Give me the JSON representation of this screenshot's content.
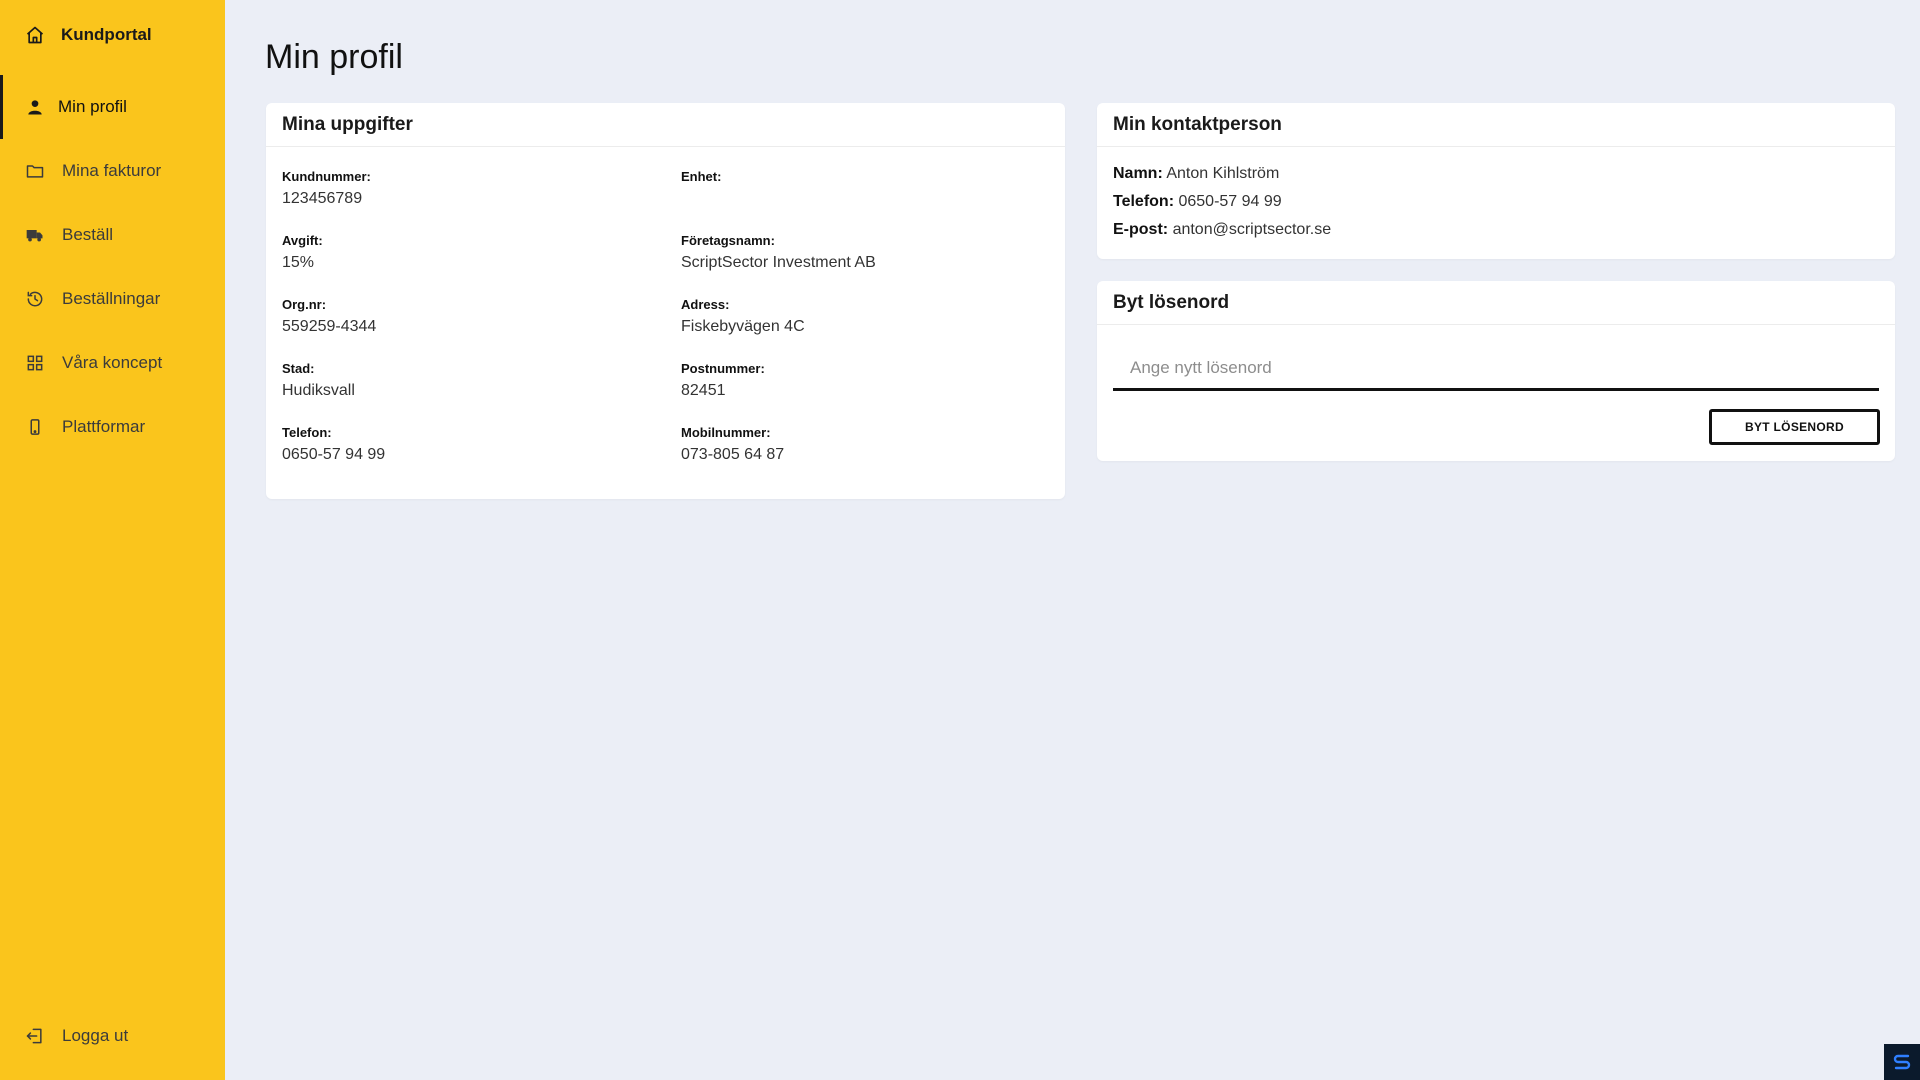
{
  "sidebar": {
    "brand": {
      "label": "Kundportal",
      "icon": "home-icon"
    },
    "items": [
      {
        "label": "Min profil",
        "icon": "user-icon",
        "active": true
      },
      {
        "label": "Mina fakturor",
        "icon": "folder-icon"
      },
      {
        "label": "Beställ",
        "icon": "truck-icon"
      },
      {
        "label": "Beställningar",
        "icon": "history-icon"
      },
      {
        "label": "Våra koncept",
        "icon": "grid-icon"
      },
      {
        "label": "Plattformar",
        "icon": "mobile-icon"
      }
    ],
    "logout": {
      "label": "Logga ut",
      "icon": "logout-icon"
    }
  },
  "page": {
    "title": "Min profil"
  },
  "details": {
    "title": "Mina uppgifter",
    "fields": [
      {
        "label": "Kundnummer:",
        "value": "123456789"
      },
      {
        "label": "Enhet:",
        "value": ""
      },
      {
        "label": "Avgift:",
        "value": "15%"
      },
      {
        "label": "Företagsnamn:",
        "value": "ScriptSector Investment AB"
      },
      {
        "label": "Org.nr:",
        "value": "559259-4344"
      },
      {
        "label": "Adress:",
        "value": "Fiskebyvägen 4C"
      },
      {
        "label": "Stad:",
        "value": "Hudiksvall"
      },
      {
        "label": "Postnummer:",
        "value": "82451"
      },
      {
        "label": "Telefon:",
        "value": "0650-57 94 99"
      },
      {
        "label": "Mobilnummer:",
        "value": "073-805 64 87"
      }
    ]
  },
  "contact": {
    "title": "Min kontaktperson",
    "name_label": "Namn:",
    "name": "Anton Kihlström",
    "phone_label": "Telefon:",
    "phone": "0650-57 94 99",
    "email_label": "E-post:",
    "email": "anton@scriptsector.se"
  },
  "password": {
    "title": "Byt lösenord",
    "placeholder": "Ange nytt lösenord",
    "button": "BYT LÖSENORD"
  },
  "colors": {
    "sidebar": "#fac51c",
    "background": "#ebeef6",
    "card": "#ffffff",
    "text": "#1a1a1a"
  }
}
